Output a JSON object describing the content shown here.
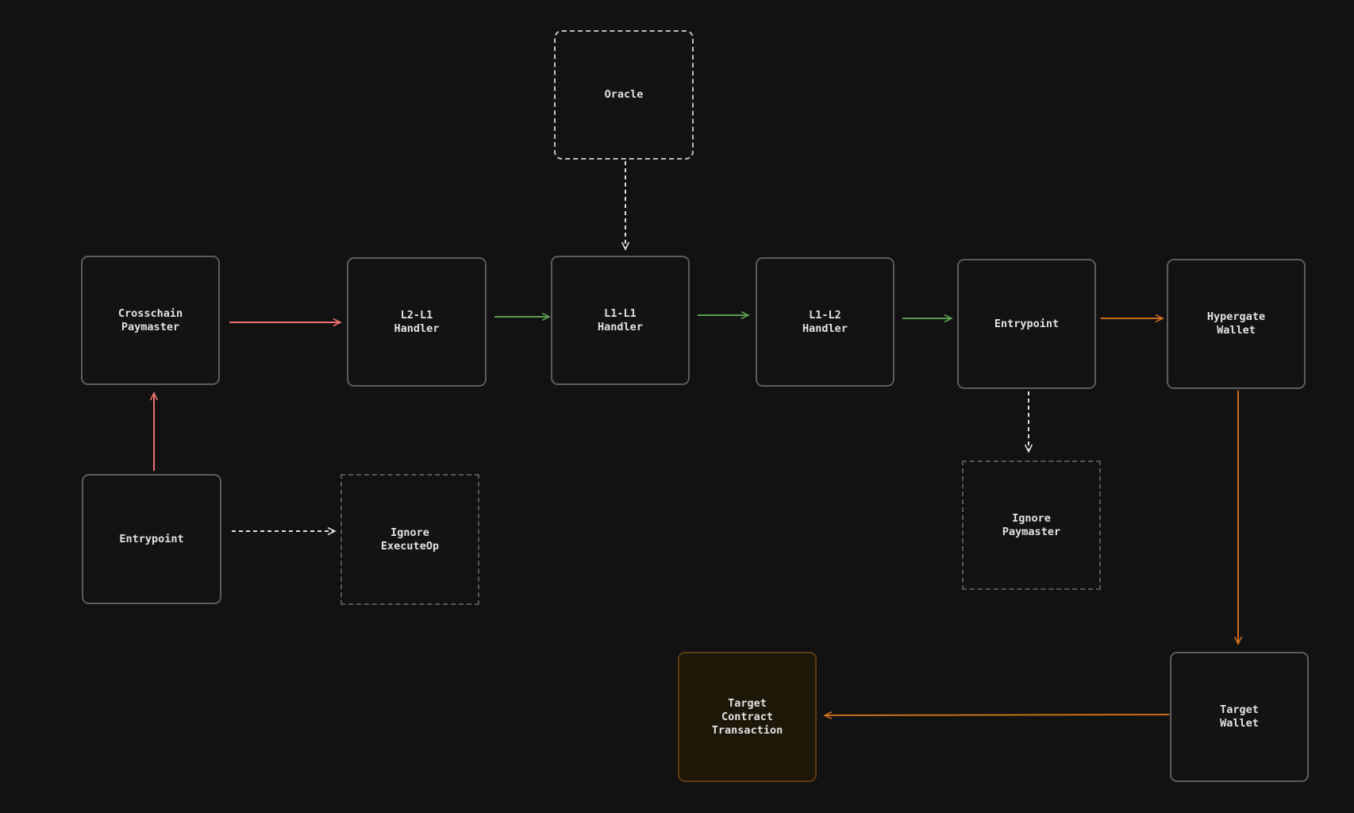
{
  "colors": {
    "background": "#121212",
    "red": "#e8736f",
    "green": "#5a9e4e",
    "orange": "#c96f1c",
    "white": "#e0e0e0",
    "node_border": "#5c5c5c"
  },
  "nodes": [
    {
      "id": "oracle",
      "label": "Oracle",
      "style": "dashed-rounded"
    },
    {
      "id": "crosschain-paymaster",
      "label": "Crosschain\nPaymaster",
      "style": "solid"
    },
    {
      "id": "l2-l1-handler",
      "label": "L2-L1\nHandler",
      "style": "solid"
    },
    {
      "id": "l1-l1-handler",
      "label": "L1-L1\nHandler",
      "style": "solid"
    },
    {
      "id": "l1-l2-handler",
      "label": "L1-L2\nHandler",
      "style": "solid"
    },
    {
      "id": "entrypoint-l2",
      "label": "Entrypoint",
      "style": "solid"
    },
    {
      "id": "hypergate-wallet",
      "label": "Hypergate\nWallet",
      "style": "solid"
    },
    {
      "id": "entrypoint-l1",
      "label": "Entrypoint",
      "style": "solid"
    },
    {
      "id": "ignore-executeop",
      "label": "Ignore\nExecuteOp",
      "style": "dashed"
    },
    {
      "id": "ignore-paymaster",
      "label": "Ignore\nPaymaster",
      "style": "dashed"
    },
    {
      "id": "target-contract-transaction",
      "label": "Target\nContract\nTransaction",
      "style": "highlighted"
    },
    {
      "id": "target-wallet",
      "label": "Target\nWallet",
      "style": "solid"
    }
  ],
  "edges": [
    {
      "from": "entrypoint-l1",
      "to": "crosschain-paymaster",
      "color": "red",
      "dashed": false
    },
    {
      "from": "crosschain-paymaster",
      "to": "l2-l1-handler",
      "color": "red",
      "dashed": false
    },
    {
      "from": "l2-l1-handler",
      "to": "l1-l1-handler",
      "color": "green",
      "dashed": false
    },
    {
      "from": "oracle",
      "to": "l1-l1-handler",
      "color": "white",
      "dashed": true
    },
    {
      "from": "l1-l1-handler",
      "to": "l1-l2-handler",
      "color": "green",
      "dashed": false
    },
    {
      "from": "l1-l2-handler",
      "to": "entrypoint-l2",
      "color": "green",
      "dashed": false
    },
    {
      "from": "entrypoint-l2",
      "to": "hypergate-wallet",
      "color": "orange",
      "dashed": false
    },
    {
      "from": "entrypoint-l2",
      "to": "ignore-paymaster",
      "color": "white",
      "dashed": true
    },
    {
      "from": "hypergate-wallet",
      "to": "target-wallet",
      "color": "orange",
      "dashed": false
    },
    {
      "from": "target-wallet",
      "to": "target-contract-transaction",
      "color": "orange",
      "dashed": false
    },
    {
      "from": "entrypoint-l1",
      "to": "ignore-executeop",
      "color": "white",
      "dashed": true
    }
  ]
}
